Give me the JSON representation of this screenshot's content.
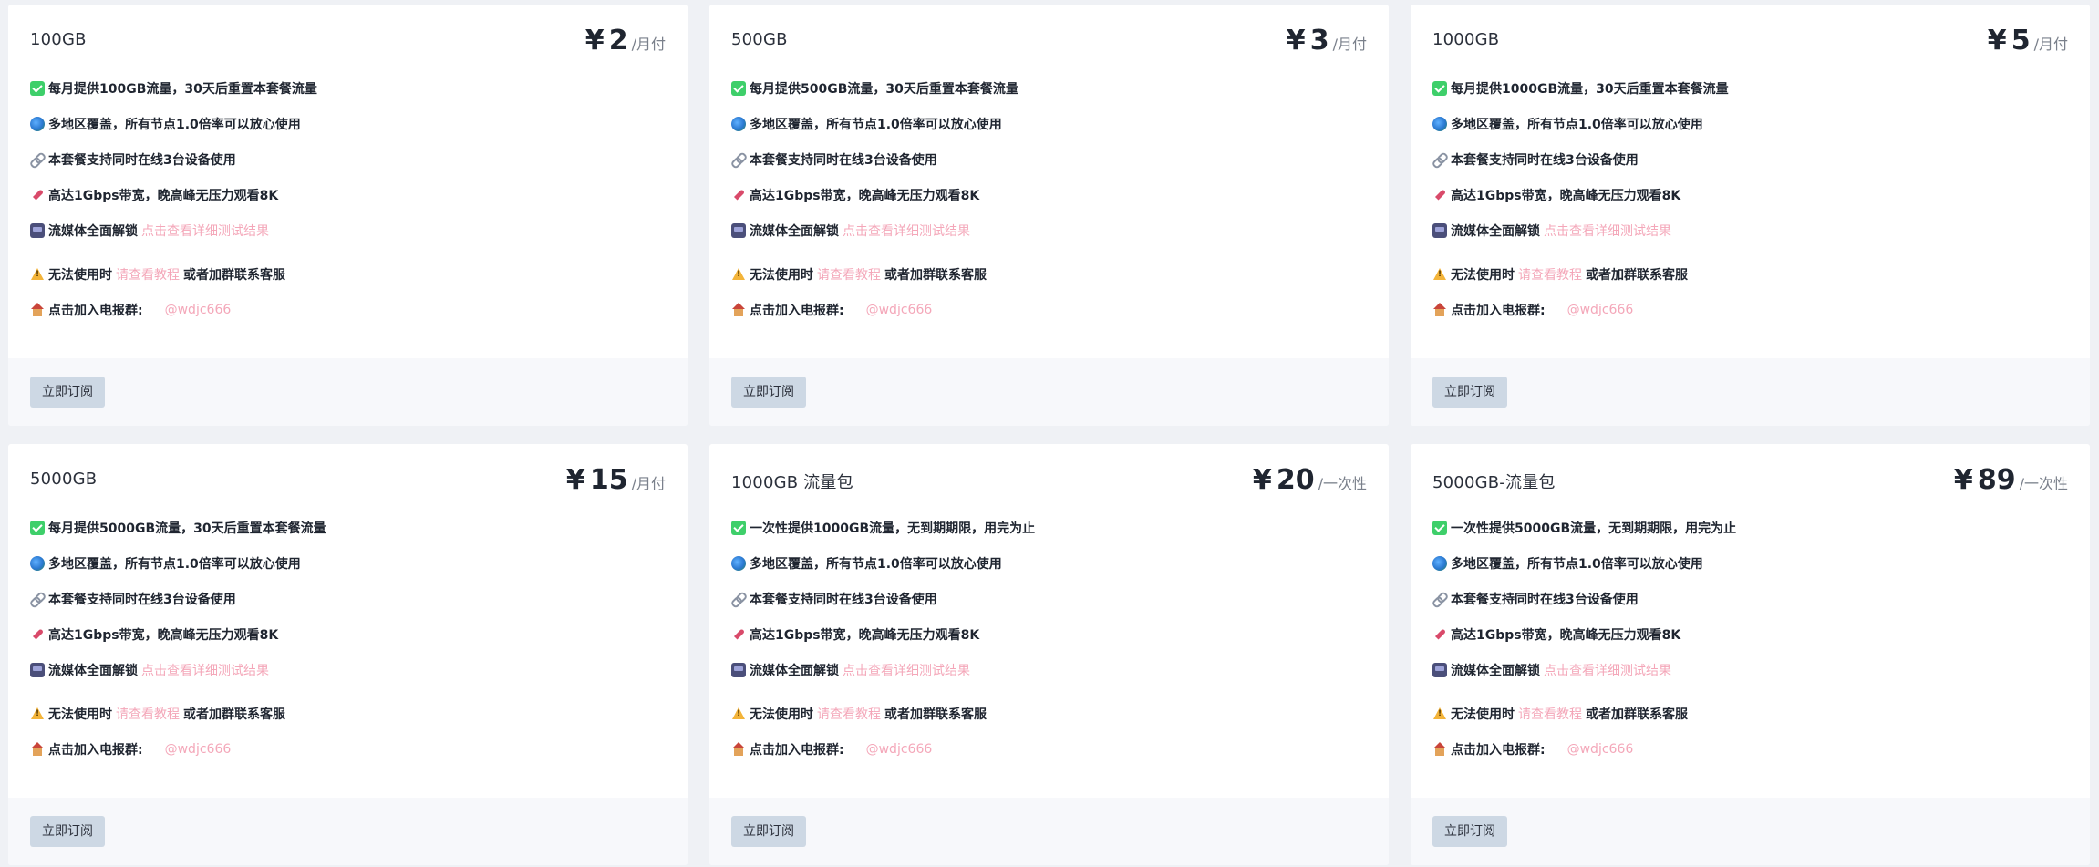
{
  "plans": [
    {
      "name": "100GB",
      "currency": "¥",
      "price": "2",
      "period": "/月付",
      "first_feature": "每月提供100GB流量，30天后重置本套餐流量"
    },
    {
      "name": "500GB",
      "currency": "¥",
      "price": "3",
      "period": "/月付",
      "first_feature": "每月提供500GB流量，30天后重置本套餐流量"
    },
    {
      "name": "1000GB",
      "currency": "¥",
      "price": "5",
      "period": "/月付",
      "first_feature": "每月提供1000GB流量，30天后重置本套餐流量"
    },
    {
      "name": "5000GB",
      "currency": "¥",
      "price": "15",
      "period": "/月付",
      "first_feature": "每月提供5000GB流量，30天后重置本套餐流量"
    },
    {
      "name": "1000GB 流量包",
      "currency": "¥",
      "price": "20",
      "period": "/一次性",
      "first_feature": "一次性提供1000GB流量，无到期期限，用完为止"
    },
    {
      "name": "5000GB-流量包",
      "currency": "¥",
      "price": "89",
      "period": "/一次性",
      "first_feature": "一次性提供5000GB流量，无到期期限，用完为止"
    }
  ],
  "common": {
    "coverage": "多地区覆盖，所有节点1.0倍率可以放心使用",
    "devices": "本套餐支持同时在线3台设备使用",
    "bandwidth": "高达1Gbps带宽，晚高峰无压力观看8K",
    "streaming": "流媒体全面解锁",
    "streaming_link": "点击查看详细测试结果",
    "trouble": "无法使用时",
    "tutorial_link": "请查看教程",
    "trouble_after": "或者加群联系客服",
    "telegram": "点击加入电报群:",
    "telegram_handle": "@wdjc666",
    "subscribe_label": "立即订阅"
  },
  "colors": {
    "page_bg": "#eff1f5",
    "card_bg": "#ffffff",
    "footer_bg": "#f7f8fb",
    "button_bg": "#cdd8e4",
    "link_pink": "#f4a7b9"
  },
  "icons": [
    "check-icon",
    "globe-icon",
    "link-icon",
    "rocket-icon",
    "media-icon",
    "warning-icon",
    "house-icon"
  ]
}
